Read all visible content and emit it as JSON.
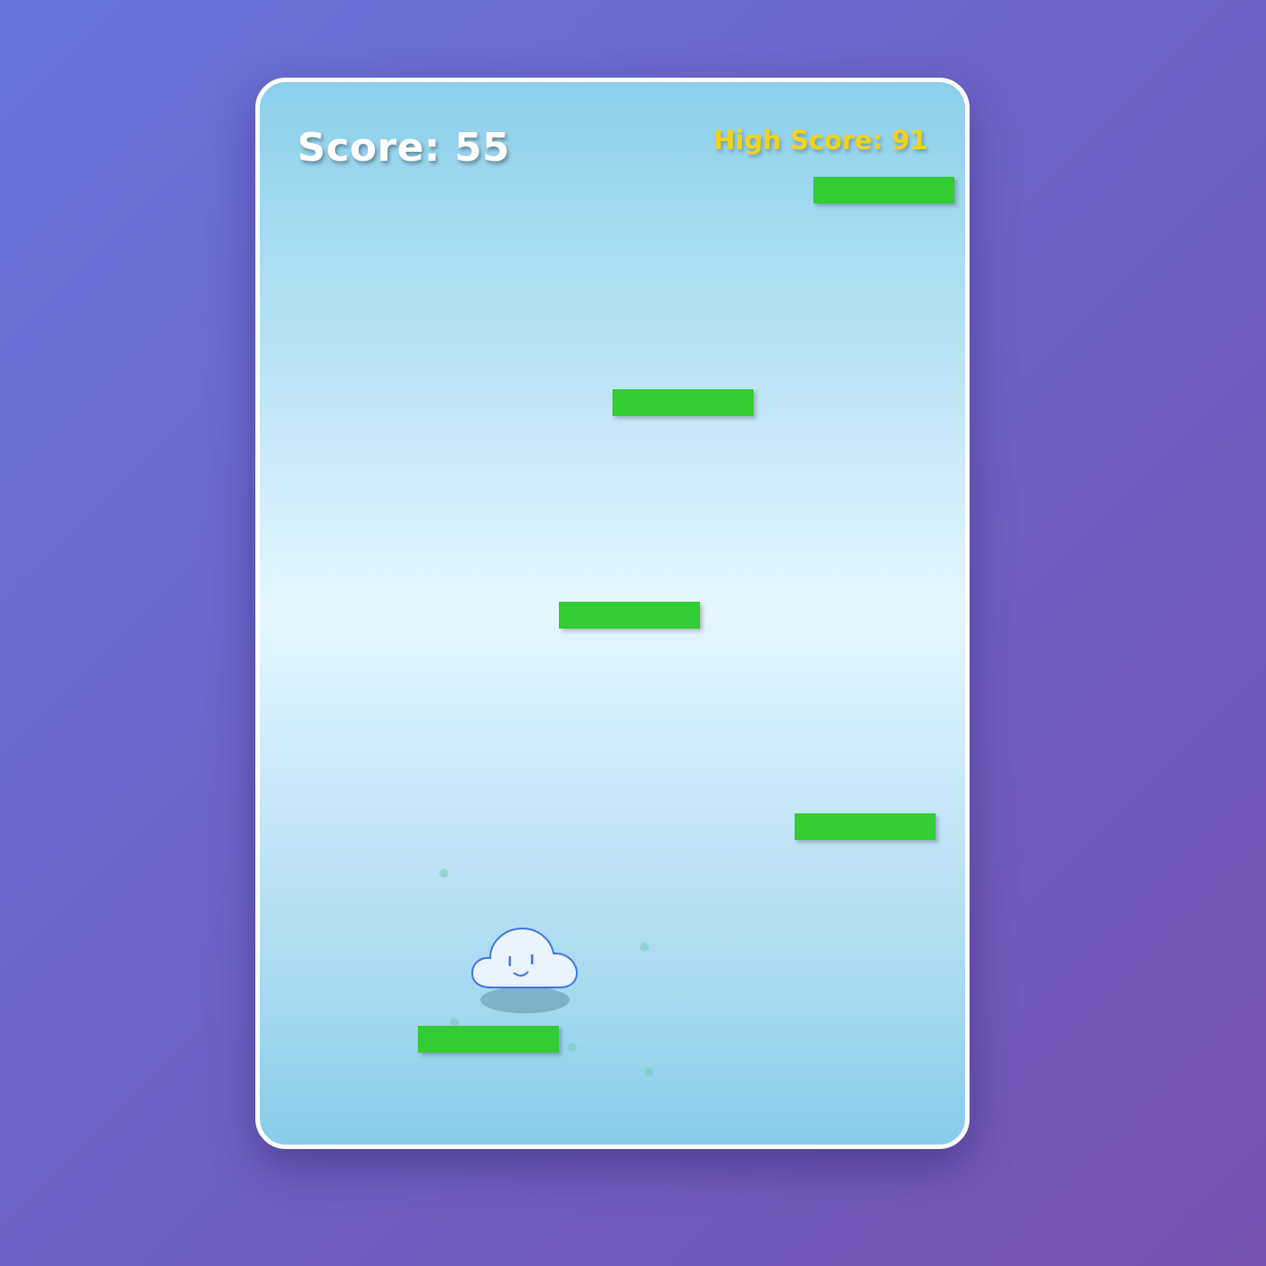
{
  "hud": {
    "score_text": "Score: 55",
    "high_score_text": "High Score: 91"
  },
  "colors": {
    "background_start": "#6a73dd",
    "background_end": "#7553b0",
    "sky_top": "#8ccfeb",
    "sky_middle": "#e6f6fd",
    "platform": "#33cc33",
    "score_text": "#ffffff",
    "high_score_text": "#f3d21b",
    "player_fill": "#eaf3fe",
    "player_outline": "#3f73e0"
  },
  "player": {
    "character": "smiling-cloud"
  },
  "icons": {
    "player": "cloud-face-icon"
  }
}
